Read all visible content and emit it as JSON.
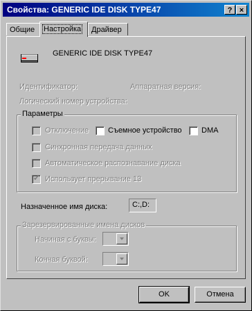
{
  "window": {
    "title": "Свойства: GENERIC IDE  DISK TYPE47",
    "help_button": "?",
    "close_button": "×"
  },
  "tabs": [
    {
      "label": "Общие",
      "active": false
    },
    {
      "label": "Настройка",
      "active": true
    },
    {
      "label": "Драйвер",
      "active": false
    }
  ],
  "device": {
    "icon": "hard-disk-icon",
    "name": "GENERIC IDE  DISK TYPE47"
  },
  "info": {
    "identifier_label": "Идентификатор:",
    "firmware_label": "Аппаратная версия:",
    "logical_label": "Логический номер устройства:"
  },
  "params": {
    "group_label": "Параметры",
    "disconnect": {
      "label": "Отключение",
      "checked": false,
      "enabled": false
    },
    "removable": {
      "label": "Съемное устройство",
      "checked": false,
      "enabled": true
    },
    "dma": {
      "label": "DMA",
      "checked": false,
      "enabled": true
    },
    "sync": {
      "label": "Синхронная передача данных",
      "checked": false,
      "enabled": false
    },
    "autodetect": {
      "label": "Автоматическое распознавание диска",
      "checked": false,
      "enabled": false
    },
    "int13": {
      "label": "Использует прерывание 13",
      "checked": true,
      "enabled": false
    }
  },
  "assigned": {
    "label": "Назначенное имя диска:",
    "value": "C:,D:"
  },
  "reserved": {
    "group_label": "Зарезервированные имена дисков",
    "start_label": "Начиная с буквы:",
    "end_label": "Кончая буквой:",
    "start_value": "",
    "end_value": ""
  },
  "buttons": {
    "ok": "OK",
    "cancel": "Отмена"
  }
}
